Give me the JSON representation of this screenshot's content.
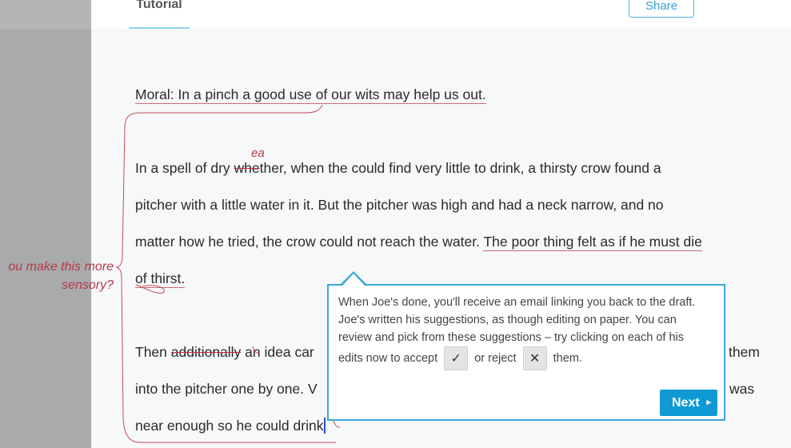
{
  "header": {
    "tab_label": "Tutorial",
    "share_label": "Share"
  },
  "document": {
    "moral": "Moral: In a pinch a good use of our wits may help us out.",
    "para1": {
      "l1_prefix": "In a spell of dry ",
      "l1_struck": "whe",
      "l1_rest": "ther, when the  could find very little to drink, a thirsty crow found a",
      "l1_insert": "ea",
      "l2": "pitcher with a little water in it. But the pitcher was high and had a neck narrow, and no",
      "l3_prefix": "matter how he tried, the crow could not reach the water. ",
      "l3_underlined": "The poor thing felt as if he must die",
      "l4": "of thirst."
    },
    "para2": {
      "l1_prefix": "Then ",
      "l1_struck": "additionally",
      "l1_rest": " an idea car",
      "l1_end": "them",
      "l2": "into the pitcher one by one. V",
      "l2_end": "was",
      "l3": "near enough so he could drink"
    }
  },
  "margin_comment": {
    "line1": "ou make this more",
    "line2": "sensory?"
  },
  "tooltip": {
    "line1": "When Joe's done, you'll receive an email linking you back to the draft.",
    "line2": "Joe's written his suggestions, as though editing on paper. You can",
    "line3": "review and pick from these suggestions – try clicking on each of his",
    "line4_a": "edits now to accept",
    "accept_glyph": "✓",
    "line4_b": "or reject",
    "reject_glyph": "✕",
    "line4_c": "them.",
    "next_label": "Next",
    "next_arrow": "▸"
  },
  "colors": {
    "accent": "#0f9ad5",
    "edit_red": "#b63a45"
  }
}
